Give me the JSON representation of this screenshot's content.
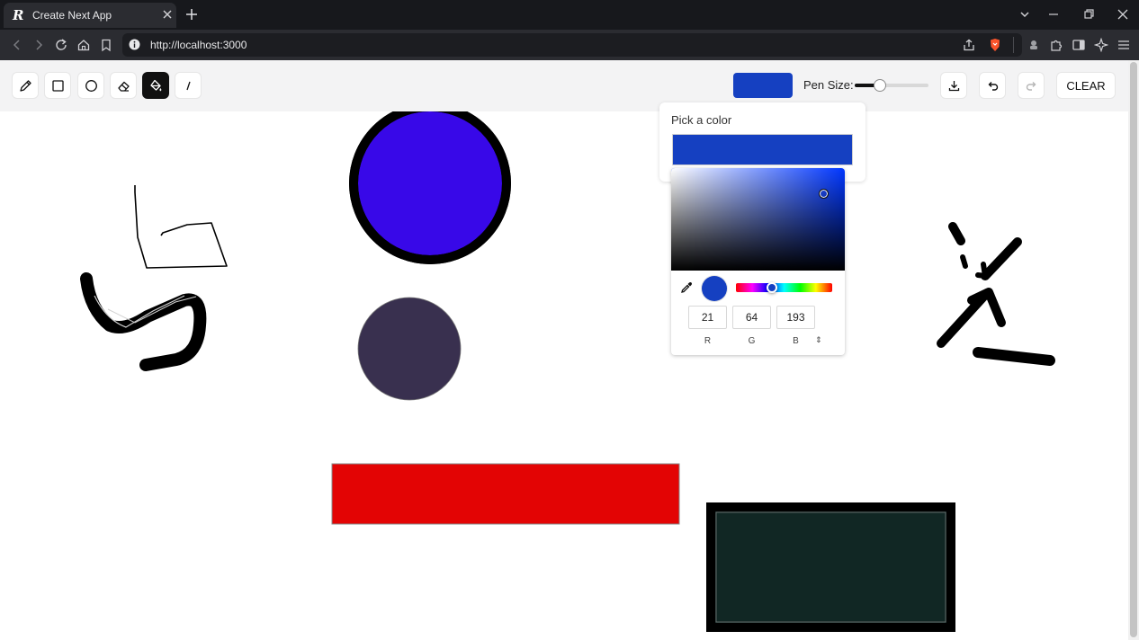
{
  "browser": {
    "tab_title": "Create Next App",
    "tab_favicon": "R",
    "url": "http://localhost:3000",
    "icons": [
      "close-icon",
      "plus-icon",
      "chevron-down-icon",
      "minimize-icon",
      "restore-icon",
      "back-icon",
      "forward-icon",
      "reload-icon",
      "home-icon",
      "bookmark-icon",
      "info-icon",
      "share-icon",
      "brave-shield-icon",
      "extensions-icon",
      "sidebar-icon",
      "leo-icon",
      "menu-icon"
    ]
  },
  "toolbar": {
    "tools": [
      {
        "name": "pencil",
        "icon": "pencil-icon",
        "active": false
      },
      {
        "name": "rectangle",
        "icon": "square-icon",
        "active": false
      },
      {
        "name": "circle",
        "icon": "circle-icon",
        "active": false
      },
      {
        "name": "eraser",
        "icon": "eraser-icon",
        "active": false
      },
      {
        "name": "fill",
        "icon": "paint-bucket-icon",
        "active": true
      },
      {
        "name": "line",
        "icon": "line-icon",
        "active": false
      }
    ],
    "current_color": "#1540c1",
    "pen_size_label": "Pen Size:",
    "pen_size_fraction": 0.34,
    "clear_label": "CLEAR"
  },
  "color_picker": {
    "title": "Pick a color",
    "selected_color": "#1540c1",
    "hue_color": "#0036ff",
    "hue_fraction": 0.37,
    "rgb": {
      "r": "21",
      "g": "64",
      "b": "193"
    },
    "labels": {
      "r": "R",
      "g": "G",
      "b": "B"
    },
    "spinner": "⇕"
  },
  "drawing_colors": {
    "big_circle_fill": "#3808e8",
    "overlap_fill": "#a3c13b",
    "dark_circle_fill": "#39304f",
    "red_rect_fill": "#e30404",
    "dark_rect_fill": "#112724",
    "stroke": "#000000"
  }
}
